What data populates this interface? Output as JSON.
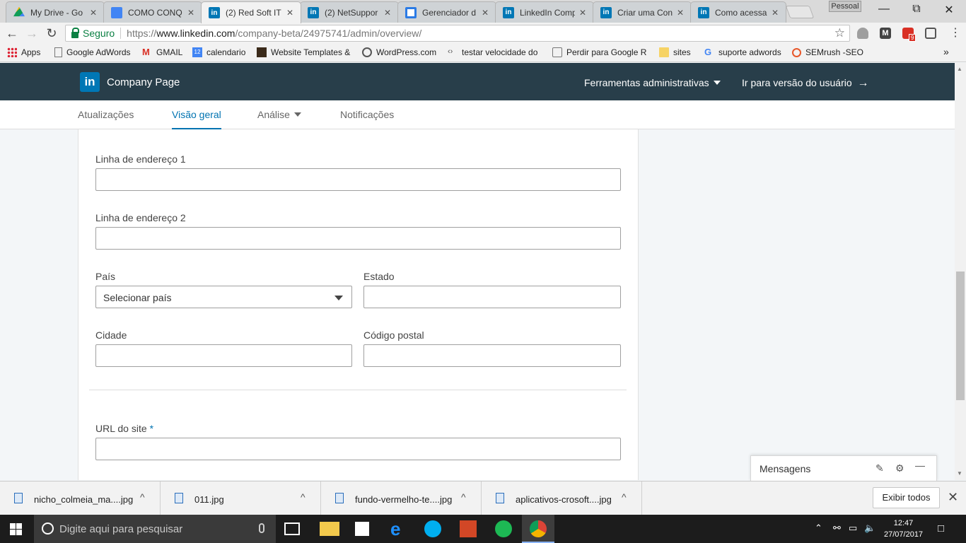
{
  "browser": {
    "tabs": [
      {
        "label": "My Drive - Go",
        "icon": "drive-icon"
      },
      {
        "label": "COMO CONQ",
        "icon": "docs-icon"
      },
      {
        "label": "(2) Red Soft IT",
        "icon": "linkedin-icon",
        "active": true
      },
      {
        "label": "(2) NetSuppor",
        "icon": "linkedin-icon"
      },
      {
        "label": "Gerenciador d",
        "icon": "gm-icon"
      },
      {
        "label": "LinkedIn Comp",
        "icon": "linkedin-icon"
      },
      {
        "label": "Criar uma Con",
        "icon": "linkedin-icon"
      },
      {
        "label": "Como acessar",
        "icon": "linkedin-icon"
      }
    ],
    "tab_close": "✕",
    "profile_label": "Pessoal",
    "address": {
      "secure_label": "Seguro",
      "url_scheme": "https://",
      "url_host": "www.linkedin.com",
      "url_path": "/company-beta/24975741/admin/overview/"
    },
    "gmail_badge": "9",
    "bookmarks": [
      {
        "label": "Apps",
        "icon": "apps-grid-icon"
      },
      {
        "label": "Google AdWords",
        "icon": "page-icon"
      },
      {
        "label": "GMAIL",
        "icon": "gmail-icon"
      },
      {
        "label": "calendario",
        "icon": "calendar-icon"
      },
      {
        "label": "Website Templates &",
        "icon": "templates-icon"
      },
      {
        "label": "WordPress.com",
        "icon": "wordpress-icon"
      },
      {
        "label": "testar velocidade do",
        "icon": "speed-icon"
      },
      {
        "label": "Perdir para Google R",
        "icon": "page-icon"
      },
      {
        "label": "sites",
        "icon": "folder-icon"
      },
      {
        "label": "suporte adwords",
        "icon": "google-icon"
      },
      {
        "label": "SEMrush -SEO",
        "icon": "semrush-icon"
      }
    ],
    "calendar_day": "12",
    "more_bookmarks": "»"
  },
  "linkedin": {
    "logo_text": "in",
    "page_title": "Company Page",
    "admin_tools": "Ferramentas administrativas",
    "user_view": "Ir para versão do usuário",
    "user_view_arrow": "→",
    "subnav": [
      {
        "label": "Atualizações"
      },
      {
        "label": "Visão geral",
        "active": true
      },
      {
        "label": "Análise",
        "dropdown": true
      },
      {
        "label": "Notificações"
      }
    ]
  },
  "form": {
    "address1_label": "Linha de endereço 1",
    "address1_value": "",
    "address2_label": "Linha de endereço 2",
    "address2_value": "",
    "country_label": "País",
    "country_value": "Selecionar país",
    "state_label": "Estado",
    "state_value": "",
    "city_label": "Cidade",
    "city_value": "",
    "postal_label": "Código postal",
    "postal_value": "",
    "website_label": "URL do site",
    "website_required": "*",
    "website_value": ""
  },
  "messages": {
    "label": "Mensagens",
    "compose_icon": "✎",
    "settings_icon": "⚙",
    "minimize_icon": "—"
  },
  "downloads": {
    "items": [
      {
        "name": "nicho_colmeia_ma....jpg"
      },
      {
        "name": "011.jpg"
      },
      {
        "name": "fundo-vermelho-te....jpg"
      },
      {
        "name": "aplicativos-crosoft....jpg"
      }
    ],
    "caret": "^",
    "show_all": "Exibir todos",
    "close": "✕"
  },
  "taskbar": {
    "search_placeholder": "Digite aqui para pesquisar",
    "time": "12:47",
    "date": "27/07/2017"
  },
  "colors": {
    "linkedin_dark": "#283e4a",
    "linkedin_blue": "#0073b1",
    "secure_green": "#0b8043"
  }
}
